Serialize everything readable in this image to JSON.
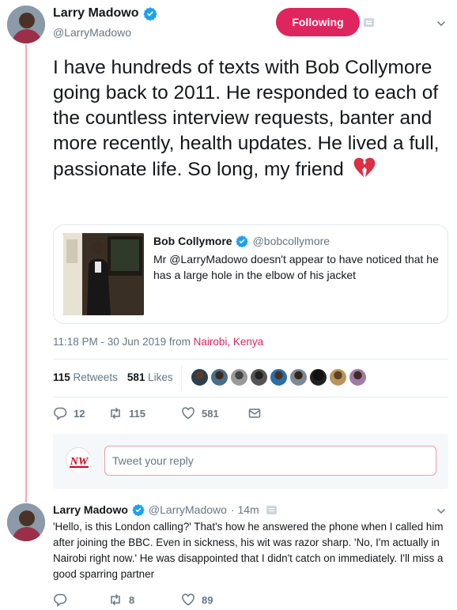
{
  "tweet": {
    "author_name": "Larry Madowo",
    "author_handle": "@LarryMadowo",
    "follow_label": "Following",
    "text": "I have hundreds of texts with Bob Collymore going back to 2011. He responded to each of the countless interview requests, banter and more recently, health updates. He lived a full, passionate life. So long, my friend",
    "emoji": "broken-heart-icon",
    "timestamp": "11:18 PM - 30 Jun 2019 from ",
    "location": "Nairobi, Kenya",
    "retweets_count": "115",
    "retweets_label": "Retweets",
    "likes_count": "581",
    "likes_label": "Likes",
    "actions": {
      "replies": "12",
      "retweets": "115",
      "likes": "581"
    }
  },
  "quote": {
    "author_name": "Bob Collymore",
    "author_handle": "@bobcollymore",
    "text": "Mr @LarryMadowo doesn't appear to have noticed that he has a large hole in the elbow of his jacket"
  },
  "reply_box": {
    "placeholder": "Tweet your reply",
    "avatar_text": "NW"
  },
  "reply": {
    "author_name": "Larry Madowo",
    "author_handle": "@LarryMadowo",
    "time": "· 14m",
    "text": "'Hello, is this London calling?' That's how he answered the phone when I called him after joining the BBC. Even in sickness, his wit was razor sharp. 'No, I'm actually in Nairobi right now.' He was disappointed that I didn't catch on immediately. I'll miss a good sparring partner",
    "actions": {
      "replies": "",
      "retweets": "8",
      "likes": "89"
    }
  },
  "colors": {
    "accent": "#e0245e",
    "verified": "#1da1f2",
    "thread_line": "#f5a8b4",
    "muted": "#657786"
  }
}
